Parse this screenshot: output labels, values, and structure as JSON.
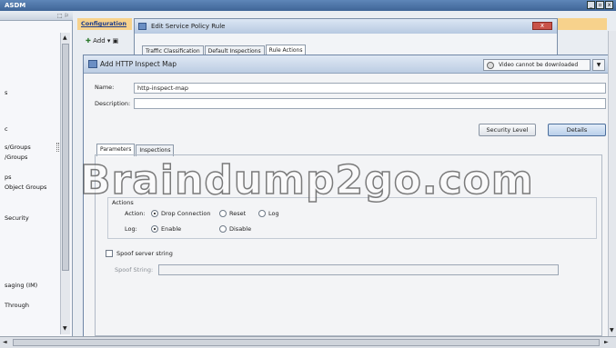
{
  "app": {
    "title": "ASDM"
  },
  "left_nav": {
    "head_icons": "⬚ ⚐",
    "items": [
      "s",
      "c",
      "s/Groups",
      "/Groups",
      "ps",
      "Object Groups",
      "Security",
      "saging (IM)",
      "Through"
    ]
  },
  "config": {
    "header": "Configuration",
    "toolbar_add": "Add",
    "toolbar_add_icon": "add-icon"
  },
  "service_policy_dialog": {
    "title": "Edit Service Policy Rule",
    "tabs": [
      "Traffic Classification",
      "Default Inspections",
      "Rule Actions"
    ]
  },
  "map_dialog": {
    "title": "Add HTTP Inspect Map",
    "video_notice": "Video cannot be downloaded",
    "name_label": "Name:",
    "name_value": "http-inspect-map",
    "description_label": "Description:",
    "description_value": "",
    "security_level_button": "Security Level",
    "details_button": "Details",
    "tabs": [
      "Parameters",
      "Inspections"
    ],
    "actions_title": "Actions",
    "action_label": "Action:",
    "action_options": [
      "Drop Connection",
      "Reset",
      "Log"
    ],
    "log_label": "Log:",
    "log_options": [
      "Enable",
      "Disable"
    ],
    "spoof_label": "Spoof server string",
    "spoof_string_label": "Spoof String:",
    "spoof_string_value": ""
  },
  "watermark": "Braindump2go.com",
  "colors": {
    "title_bar": "#3f6597",
    "config_header": "#f7d28c",
    "close_button": "#c9534a"
  }
}
